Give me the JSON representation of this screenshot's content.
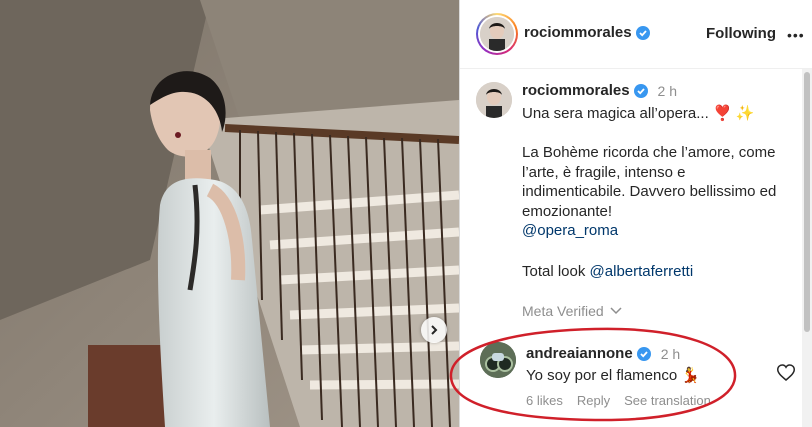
{
  "post": {
    "account": "rociommorales",
    "follow_label": "Following",
    "more_label": "•••"
  },
  "caption": {
    "username": "rociommorales",
    "time": "2 h",
    "line1": "Una sera magica all’opera...",
    "line1_emoji": "❣️ ✨",
    "body_lines": [
      "La Bohème ricorda che l’amore, come",
      "l’arte, è fragile, intenso e",
      "indimenticabile. Davvero bellissimo ed",
      "emozionante!"
    ],
    "mention1": "@opera_roma",
    "total_look_prefix": "Total look ",
    "mention2": "@albertaferretti",
    "meta_verified": "Meta Verified"
  },
  "comment": {
    "username": "andreaiannone",
    "time": "2 h",
    "text": "Yo soy por el flamenco",
    "emoji": "💃",
    "likes": "6 likes",
    "reply": "Reply",
    "see_translation": "See translation"
  },
  "colors": {
    "verified": "#3897f0",
    "link": "#00376b",
    "annotation": "#d0202a",
    "muted": "#8e8e8e"
  },
  "icons": [
    "verified-badge-icon",
    "chevron-down-icon",
    "heart-icon",
    "next-arrow-icon"
  ]
}
